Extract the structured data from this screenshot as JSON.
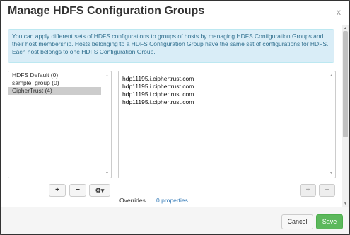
{
  "modal": {
    "title": "Manage HDFS Configuration Groups",
    "close": "x"
  },
  "info_text": "You can apply different sets of HDFS configurations to groups of hosts by managing HDFS Configuration Groups and their host membership. Hosts belonging to a HDFS Configuration Group have the same set of configurations for HDFS. Each host belongs to one HDFS Configuration Group.",
  "groups": [
    {
      "label": "HDFS Default (0)"
    },
    {
      "label": "sample_group (0)"
    },
    {
      "label": "CipherTrust (4)",
      "selected": true
    }
  ],
  "hosts": [
    "hdp11195.i.ciphertrust.com",
    "hdp11195.i.ciphertrust.com",
    "hdp11195.i.ciphertrust.com",
    "hdp11195.i.ciphertrust.com"
  ],
  "group_buttons": {
    "add": "+",
    "remove": "−",
    "gear": "⚙▾"
  },
  "host_buttons": {
    "add": "+",
    "remove": "−"
  },
  "overrides": {
    "label": "Overrides",
    "link": "0 properties"
  },
  "footer": {
    "cancel": "Cancel",
    "save": "Save"
  },
  "colors": {
    "save": "#5cb85c",
    "info_bg": "#d9edf7",
    "link": "#337ab7"
  }
}
